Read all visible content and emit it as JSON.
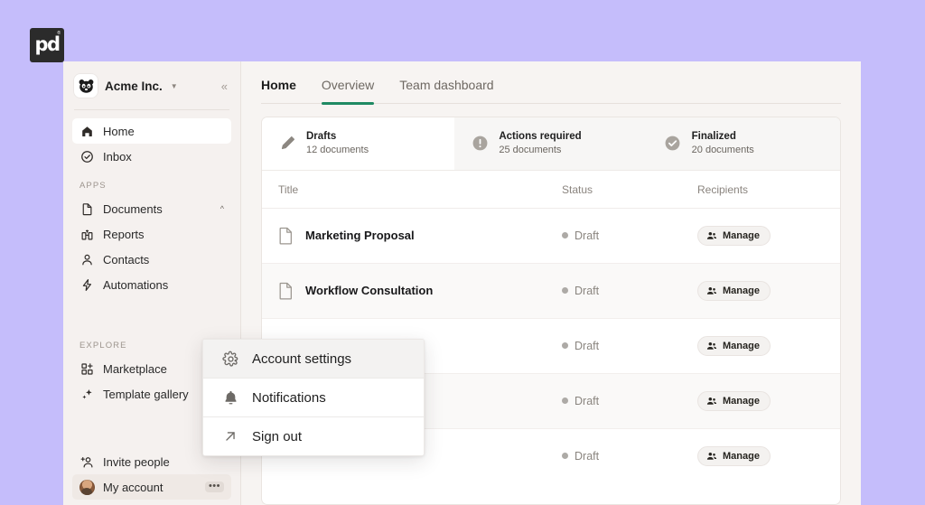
{
  "brand": {
    "mark": "pd",
    "trademark": "®",
    "name": "brand-logo"
  },
  "sidebar": {
    "workspace": {
      "name": "Acme Inc.",
      "caret_icon": "chevron-down-icon",
      "collapse_icon": "double-chevron-left-icon",
      "avatar_icon": "panda-avatar"
    },
    "primary": [
      {
        "label": "Home",
        "icon": "home-icon",
        "active": true
      },
      {
        "label": "Inbox",
        "icon": "check-circle-icon",
        "active": false
      }
    ],
    "apps_label": "APPS",
    "apps": [
      {
        "label": "Documents",
        "icon": "document-icon",
        "chevron": "chevron-up-icon"
      },
      {
        "label": "Reports",
        "icon": "bar-chart-icon"
      },
      {
        "label": "Contacts",
        "icon": "person-icon"
      },
      {
        "label": "Automations",
        "icon": "lightning-icon"
      }
    ],
    "explore_label": "EXPLORE",
    "explore": [
      {
        "label": "Marketplace",
        "icon": "grid-plus-icon"
      },
      {
        "label": "Template gallery",
        "icon": "sparkle-icon"
      }
    ],
    "bottom": [
      {
        "label": "Invite people",
        "icon": "person-plus-icon"
      },
      {
        "label": "My account",
        "icon": "user-avatar",
        "more_icon": "ellipsis-icon",
        "active": true
      }
    ]
  },
  "main": {
    "tabs": [
      {
        "label": "Home",
        "selected": false,
        "is_title": true
      },
      {
        "label": "Overview",
        "selected": true,
        "is_title": false
      },
      {
        "label": "Team dashboard",
        "selected": false,
        "is_title": false
      }
    ],
    "stats": [
      {
        "title": "Drafts",
        "subtitle": "12 documents",
        "icon": "pencil-icon",
        "active": true
      },
      {
        "title": "Actions required",
        "subtitle": "25 documents",
        "icon": "exclamation-circle-icon",
        "active": false
      },
      {
        "title": "Finalized",
        "subtitle": "20 documents",
        "icon": "check-circle-filled-icon",
        "active": false
      }
    ],
    "table": {
      "columns": {
        "title": "Title",
        "status": "Status",
        "recipients": "Recipients"
      },
      "rows": [
        {
          "title": "Marketing Proposal",
          "status": "Draft",
          "action": "Manage"
        },
        {
          "title": "Workflow Consultation",
          "status": "Draft",
          "action": "Manage"
        },
        {
          "title": "",
          "status": "Draft",
          "action": "Manage"
        },
        {
          "title": "",
          "status": "Draft",
          "action": "Manage"
        },
        {
          "title": "",
          "status": "Draft",
          "action": "Manage"
        }
      ]
    }
  },
  "context_menu": {
    "items": [
      {
        "label": "Account settings",
        "icon": "gear-icon",
        "highlighted": true
      },
      {
        "label": "Notifications",
        "icon": "bell-icon",
        "highlighted": false
      },
      {
        "label": "Sign out",
        "icon": "arrow-up-right-icon",
        "highlighted": false
      }
    ]
  },
  "colors": {
    "page_background": "#c5bdfb",
    "sidebar_background": "#f5f1ef",
    "main_background": "#f7f4f2",
    "accent_green": "#1f8a63",
    "card_background": "#ffffff"
  }
}
